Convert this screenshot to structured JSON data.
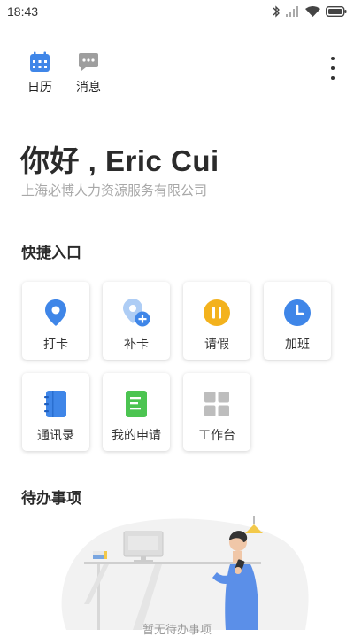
{
  "status_bar": {
    "time": "18:43"
  },
  "top_nav": {
    "calendar_label": "日历",
    "messages_label": "消息"
  },
  "greeting": "你好 , Eric Cui",
  "company": "上海必博人力资源服务有限公司",
  "quick_access": {
    "title": "快捷入口",
    "tiles": [
      {
        "label": "打卡",
        "icon": "location-pin-icon"
      },
      {
        "label": "补卡",
        "icon": "location-add-icon"
      },
      {
        "label": "请假",
        "icon": "pause-icon"
      },
      {
        "label": "加班",
        "icon": "clock-icon"
      },
      {
        "label": "通讯录",
        "icon": "contacts-book-icon"
      },
      {
        "label": "我的申请",
        "icon": "document-icon"
      },
      {
        "label": "工作台",
        "icon": "grid-icon"
      }
    ]
  },
  "todo": {
    "title": "待办事项",
    "empty_text": "暂无待办事项"
  },
  "colors": {
    "blue": "#3f86e8",
    "orange": "#f3b21d",
    "green": "#4cc451",
    "gray_icon": "#bdbdbd"
  }
}
